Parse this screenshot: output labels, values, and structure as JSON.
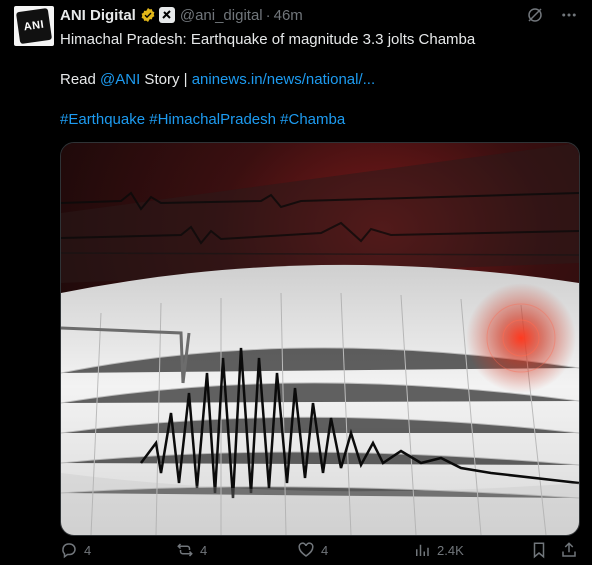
{
  "tweet": {
    "author_name": "ANI Digital",
    "handle": "@ani_digital",
    "separator": "·",
    "time": "46m",
    "avatar_text": "ANI",
    "line1": "Himachal Pradesh: Earthquake of magnitude 3.3 jolts Chamba",
    "read_prefix": "Read ",
    "mention": "@ANI",
    "story_text": " Story | ",
    "link_text": "aninews.in/news/national/...",
    "hashtags": [
      "#Earthquake",
      "#HimachalPradesh",
      "#Chamba"
    ]
  },
  "actions": {
    "replies": "4",
    "reposts": "4",
    "likes": "4",
    "views": "2.4K"
  },
  "colors": {
    "accent": "#1d9bf0",
    "muted": "#71767b",
    "verified": "#e2b719"
  }
}
